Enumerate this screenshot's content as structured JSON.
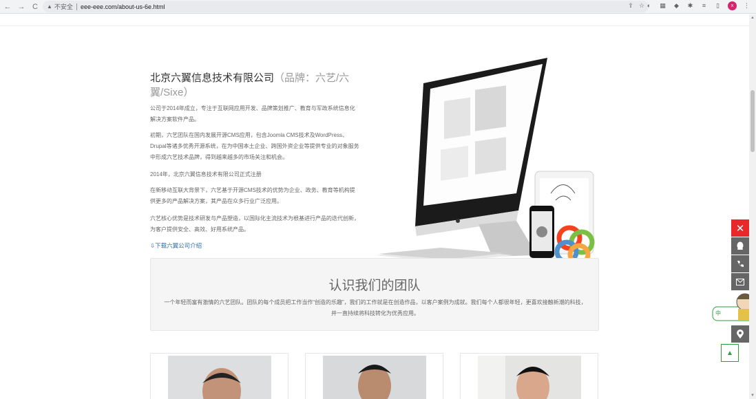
{
  "browser": {
    "back_icon": "←",
    "forward_icon": "→",
    "reload_icon": "C",
    "insecure_label": "不安全",
    "url": "eee-eee.com/about-us-6e.html",
    "profile_initial": "x"
  },
  "company": {
    "name": "北京六翼信息技术有限公司",
    "brand": "（品牌：六艺/六翼/Sixe）",
    "paragraphs": [
      "公司于2014年成立，专注于互联网应用开发、品牌策划推广、教育与军政系统信息化解决方案软件产品。",
      "初期，六艺团队在国内发展开源CMS应用，包含Joomla CMS技术及WordPress、Drupal等诸多优秀开源系统，在为中国本土企业、跨国外资企业等提供专业的对象服务中形成六艺技术品牌，得到越来越多的市场关注和机会。",
      "2014年，北京六翼信息技术有限公司正式注册",
      "在新移动互联大背景下，六艺基于开源CMS技术的优势为企业、政务、教育等机构提供更多的产品解决方案，其产品在众多行业广泛应用。",
      "六艺核心优势是技术研发与产品塑造，以国际化主流技术为根基进行产品的迭代创新，为客户提供安全、高效、好用系统产品。"
    ],
    "download_label": "下载六翼公司介绍",
    "download_icon": "⇩"
  },
  "team": {
    "title": "认识我们的团队",
    "description_line1": "一个年轻而富有激情的六艺团队。团队的每个成员把工作当作“创造的乐趣”，我们的工作就是在创造作品，以客户案例为成就。我们每个人都很年轻，更喜欢接触新潮的科技，",
    "description_line2": "并一直持续将科技转化为优秀应用。"
  },
  "sidebar": {
    "close_icon": "✕",
    "qq_icon": "qq-penguin-icon",
    "phone_icon": "phone-icon",
    "mail_icon": "mail-icon",
    "location_icon": "location-pin-icon",
    "to_top_icon": "▲"
  },
  "colors": {
    "accent_red": "#e8282b",
    "accent_green": "#2e9e3e",
    "link_blue": "#2a6db6"
  }
}
